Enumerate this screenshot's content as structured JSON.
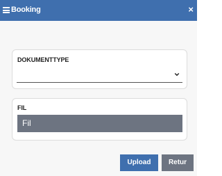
{
  "dialog": {
    "title": "Booking",
    "close_label": "×",
    "menu_icon": "hamburger-menu-icon",
    "colors": {
      "titlebar": "#3f6fae",
      "primary_button": "#3f6fae",
      "secondary_button": "#6d7481"
    }
  },
  "document_type": {
    "label": "DOKUMENTTYPE",
    "selected_value": "",
    "icon": "chevron-down-icon"
  },
  "file": {
    "label": "FIL",
    "button_text": "Fil"
  },
  "buttons": {
    "upload_label": "Upload",
    "retur_label": "Retur"
  }
}
